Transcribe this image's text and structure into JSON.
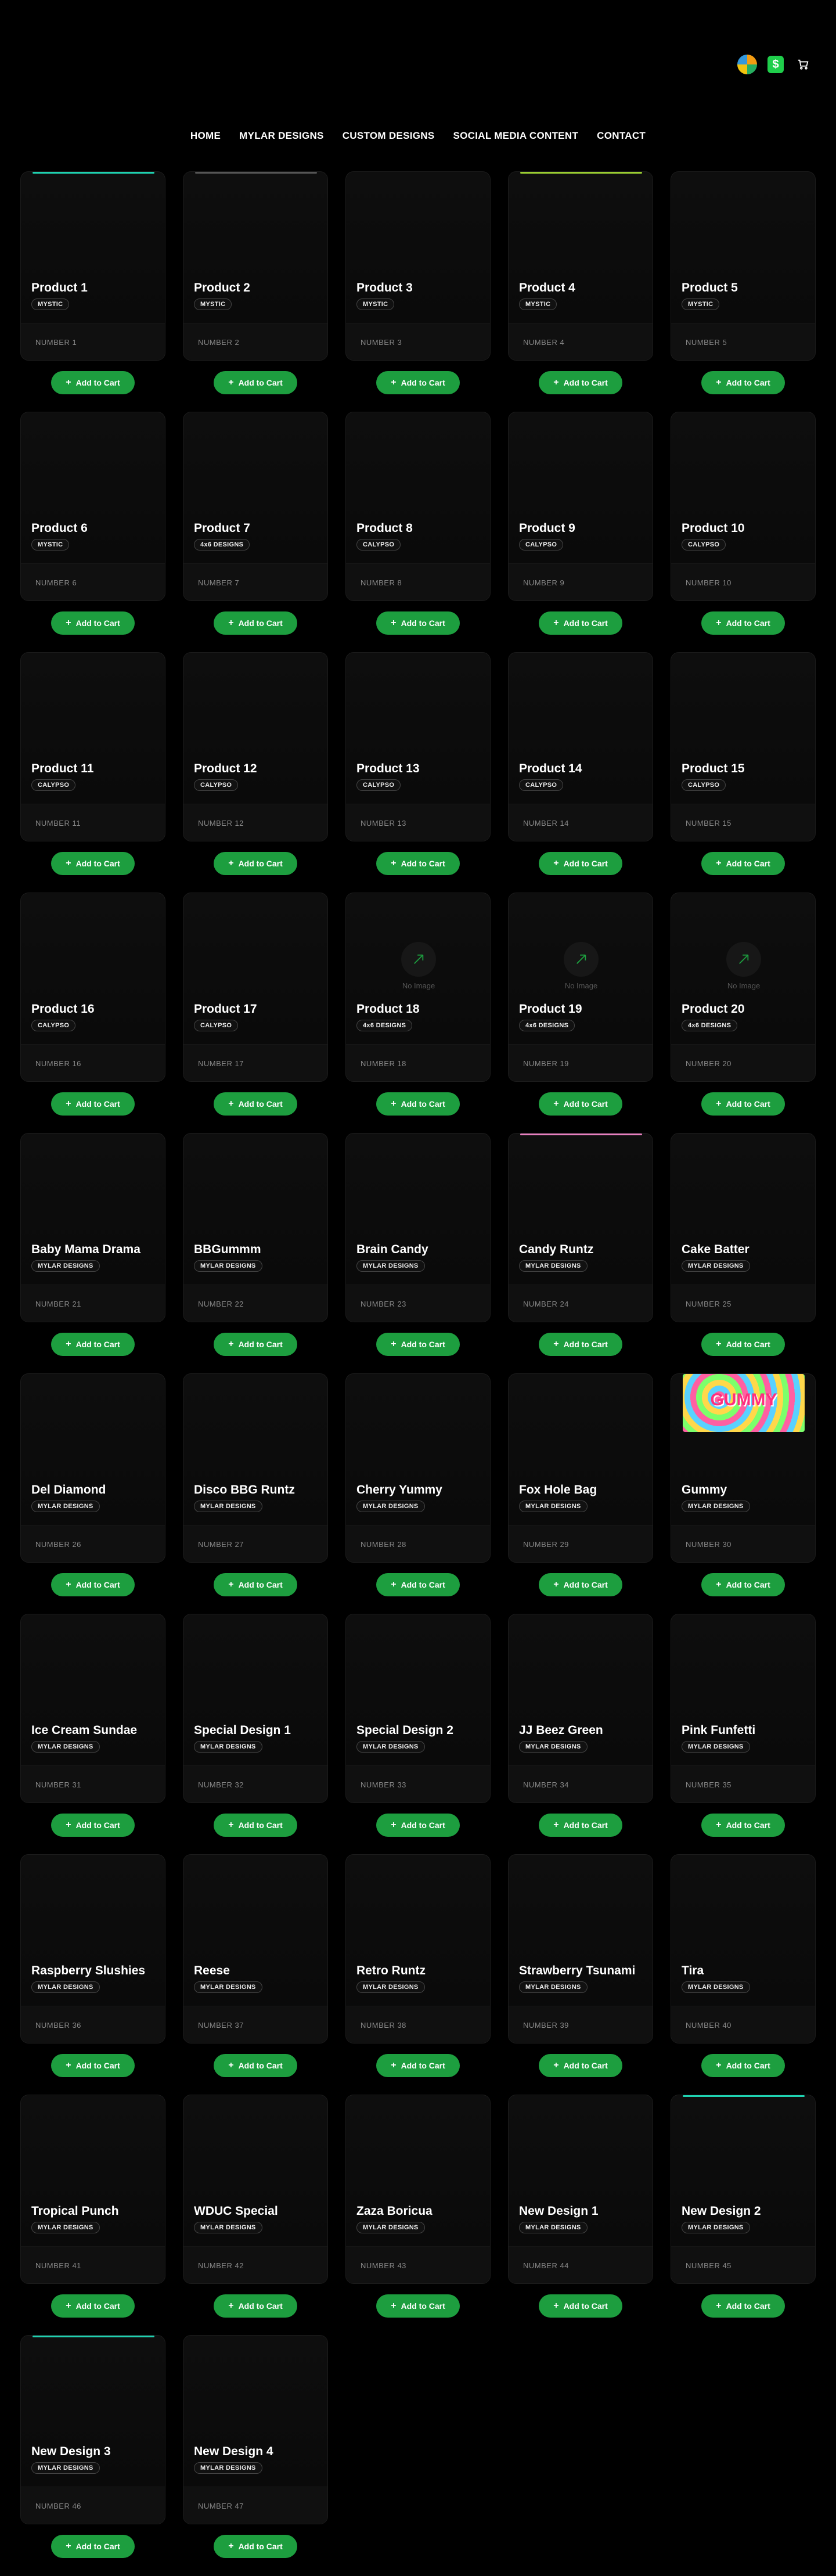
{
  "header": {
    "icons": [
      "color-wheel-icon",
      "dollar-icon",
      "cart-icon"
    ],
    "dollar_symbol": "$"
  },
  "nav": {
    "items": [
      {
        "label": "HOME"
      },
      {
        "label": "MYLAR DESIGNS"
      },
      {
        "label": "CUSTOM DESIGNS"
      },
      {
        "label": "SOCIAL MEDIA CONTENT"
      },
      {
        "label": "CONTACT"
      }
    ]
  },
  "colors": {
    "accent_green": "#1d9e3f",
    "background": "#000000",
    "card": "#0c0c0c"
  },
  "add_to_cart_label": "Add to Cart",
  "no_image_label": "No Image",
  "products": [
    {
      "name": "Product 1",
      "tag": "MYSTIC",
      "number": "NUMBER 1",
      "accent": "#1fd1b0"
    },
    {
      "name": "Product 2",
      "tag": "MYSTIC",
      "number": "NUMBER 2",
      "accent": "#555555"
    },
    {
      "name": "Product 3",
      "tag": "MYSTIC",
      "number": "NUMBER 3"
    },
    {
      "name": "Product 4",
      "tag": "MYSTIC",
      "number": "NUMBER 4",
      "accent": "#9acd32"
    },
    {
      "name": "Product 5",
      "tag": "MYSTIC",
      "number": "NUMBER 5"
    },
    {
      "name": "Product 6",
      "tag": "MYSTIC",
      "number": "NUMBER 6"
    },
    {
      "name": "Product 7",
      "tag": "4x6 DESIGNS",
      "number": "NUMBER 7"
    },
    {
      "name": "Product 8",
      "tag": "CALYPSO",
      "number": "NUMBER 8"
    },
    {
      "name": "Product 9",
      "tag": "CALYPSO",
      "number": "NUMBER 9"
    },
    {
      "name": "Product 10",
      "tag": "CALYPSO",
      "number": "NUMBER 10"
    },
    {
      "name": "Product 11",
      "tag": "CALYPSO",
      "number": "NUMBER 11"
    },
    {
      "name": "Product 12",
      "tag": "CALYPSO",
      "number": "NUMBER 12"
    },
    {
      "name": "Product 13",
      "tag": "CALYPSO",
      "number": "NUMBER 13"
    },
    {
      "name": "Product 14",
      "tag": "CALYPSO",
      "number": "NUMBER 14"
    },
    {
      "name": "Product 15",
      "tag": "CALYPSO",
      "number": "NUMBER 15"
    },
    {
      "name": "Product 16",
      "tag": "CALYPSO",
      "number": "NUMBER 16"
    },
    {
      "name": "Product 17",
      "tag": "CALYPSO",
      "number": "NUMBER 17"
    },
    {
      "name": "Product 18",
      "tag": "4x6 DESIGNS",
      "number": "NUMBER 18",
      "noimage": true
    },
    {
      "name": "Product 19",
      "tag": "4x6 DESIGNS",
      "number": "NUMBER 19",
      "noimage": true
    },
    {
      "name": "Product 20",
      "tag": "4x6 DESIGNS",
      "number": "NUMBER 20",
      "noimage": true
    },
    {
      "name": "Baby Mama Drama",
      "tag": "MYLAR DESIGNS",
      "number": "NUMBER 21"
    },
    {
      "name": "BBGummm",
      "tag": "MYLAR DESIGNS",
      "number": "NUMBER 22"
    },
    {
      "name": "Brain Candy",
      "tag": "MYLAR DESIGNS",
      "number": "NUMBER 23"
    },
    {
      "name": "Candy Runtz",
      "tag": "MYLAR DESIGNS",
      "number": "NUMBER 24",
      "accent": "#e87fc0"
    },
    {
      "name": "Cake Batter",
      "tag": "MYLAR DESIGNS",
      "number": "NUMBER 25"
    },
    {
      "name": "Del Diamond",
      "tag": "MYLAR DESIGNS",
      "number": "NUMBER 26"
    },
    {
      "name": "Disco BBG Runtz",
      "tag": "MYLAR DESIGNS",
      "number": "NUMBER 27"
    },
    {
      "name": "Cherry Yummy",
      "tag": "MYLAR DESIGNS",
      "number": "NUMBER 28"
    },
    {
      "name": "Fox Hole Bag",
      "tag": "MYLAR DESIGNS",
      "number": "NUMBER 29"
    },
    {
      "name": "Gummy",
      "tag": "MYLAR DESIGNS",
      "number": "NUMBER 30",
      "thumb_text": "GUMMY"
    },
    {
      "name": "Ice Cream Sundae",
      "tag": "MYLAR DESIGNS",
      "number": "NUMBER 31"
    },
    {
      "name": "Special Design 1",
      "tag": "MYLAR DESIGNS",
      "number": "NUMBER 32"
    },
    {
      "name": "Special Design 2",
      "tag": "MYLAR DESIGNS",
      "number": "NUMBER 33"
    },
    {
      "name": "JJ Beez Green",
      "tag": "MYLAR DESIGNS",
      "number": "NUMBER 34"
    },
    {
      "name": "Pink Funfetti",
      "tag": "MYLAR DESIGNS",
      "number": "NUMBER 35"
    },
    {
      "name": "Raspberry Slushies",
      "tag": "MYLAR DESIGNS",
      "number": "NUMBER 36"
    },
    {
      "name": "Reese",
      "tag": "MYLAR DESIGNS",
      "number": "NUMBER 37"
    },
    {
      "name": "Retro Runtz",
      "tag": "MYLAR DESIGNS",
      "number": "NUMBER 38"
    },
    {
      "name": "Strawberry Tsunami",
      "tag": "MYLAR DESIGNS",
      "number": "NUMBER 39"
    },
    {
      "name": "Tira",
      "tag": "MYLAR DESIGNS",
      "number": "NUMBER 40"
    },
    {
      "name": "Tropical Punch",
      "tag": "MYLAR DESIGNS",
      "number": "NUMBER 41"
    },
    {
      "name": "WDUC Special",
      "tag": "MYLAR DESIGNS",
      "number": "NUMBER 42"
    },
    {
      "name": "Zaza Boricua",
      "tag": "MYLAR DESIGNS",
      "number": "NUMBER 43"
    },
    {
      "name": "New Design 1",
      "tag": "MYLAR DESIGNS",
      "number": "NUMBER 44"
    },
    {
      "name": "New Design 2",
      "tag": "MYLAR DESIGNS",
      "number": "NUMBER 45",
      "accent": "#1fd1b0"
    },
    {
      "name": "New Design 3",
      "tag": "MYLAR DESIGNS",
      "number": "NUMBER 46",
      "accent": "#1fd1b0"
    },
    {
      "name": "New Design 4",
      "tag": "MYLAR DESIGNS",
      "number": "NUMBER 47"
    }
  ]
}
